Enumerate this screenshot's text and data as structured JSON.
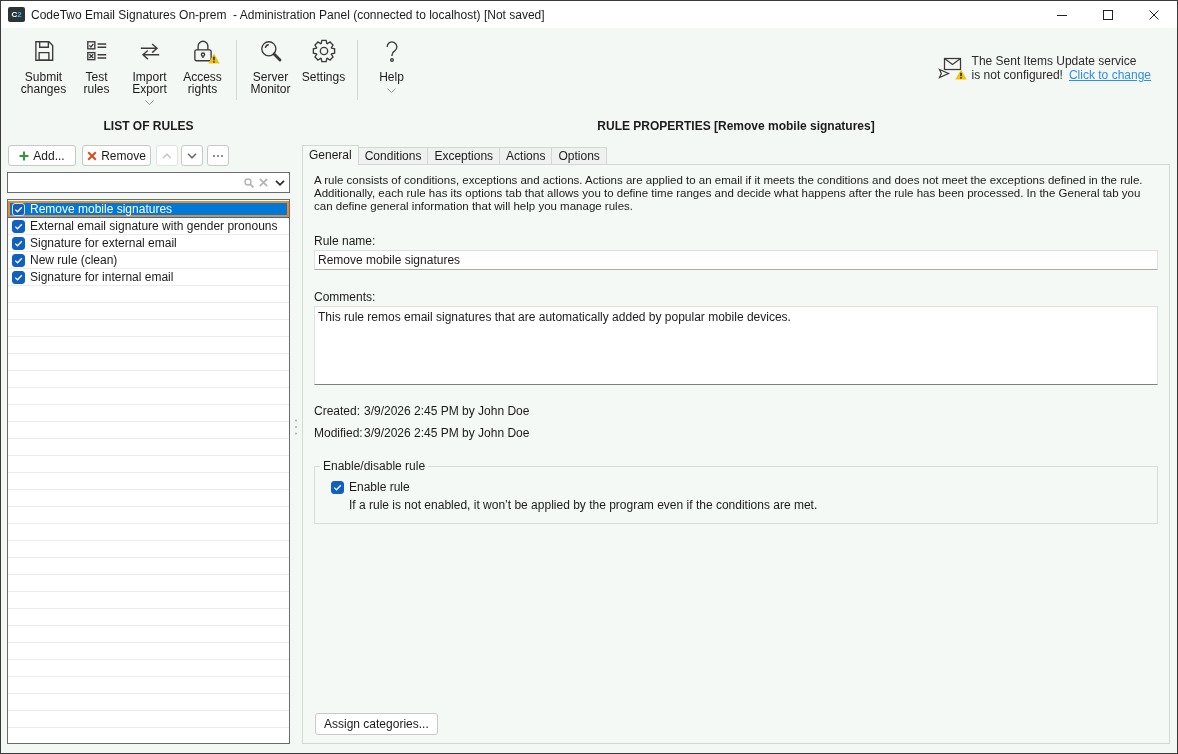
{
  "window": {
    "icon_text": "C2",
    "title": "CodeTwo Email Signatures On-prem  - Administration Panel (connected to localhost) [Not saved]"
  },
  "toolbar": {
    "groups": [
      [
        {
          "label": "Submit changes",
          "dropdown": false,
          "warning": false
        },
        {
          "label": "Test rules",
          "dropdown": false,
          "warning": false
        },
        {
          "label": "Import Export",
          "dropdown": true,
          "warning": false
        },
        {
          "label": "Access rights",
          "dropdown": false,
          "warning": true
        }
      ],
      [
        {
          "label": "Server Monitor",
          "dropdown": false,
          "warning": false
        },
        {
          "label": "Settings",
          "dropdown": false,
          "warning": false
        }
      ],
      [
        {
          "label": "Help",
          "dropdown": true,
          "warning": false
        }
      ]
    ]
  },
  "notice": {
    "text_lines": [
      "The Sent Items Update service",
      "is not configured!"
    ],
    "link": "Click to change"
  },
  "left_panel": {
    "title": "LIST OF RULES",
    "buttons": [
      {
        "kind": "add",
        "label": "Add...",
        "disabled": false
      },
      {
        "kind": "remove",
        "label": "Remove",
        "disabled": false
      },
      {
        "kind": "up",
        "disabled": true
      },
      {
        "kind": "down",
        "disabled": false
      },
      {
        "kind": "more",
        "disabled": false
      }
    ],
    "rules": [
      {
        "name": "Remove mobile signatures",
        "checked": true,
        "selected": true
      },
      {
        "name": "External email signature with gender pronouns",
        "checked": true,
        "selected": false
      },
      {
        "name": "Signature for external email",
        "checked": true,
        "selected": false
      },
      {
        "name": "New rule (clean)",
        "checked": true,
        "selected": false
      },
      {
        "name": "Signature for internal email",
        "checked": true,
        "selected": false
      }
    ]
  },
  "right_panel": {
    "title": "RULE PROPERTIES [Remove mobile signatures]",
    "tabs": [
      {
        "label": "General",
        "selected": true
      },
      {
        "label": "Conditions",
        "selected": false
      },
      {
        "label": "Exceptions",
        "selected": false
      },
      {
        "label": "Actions",
        "selected": false
      },
      {
        "label": "Options",
        "selected": false
      }
    ],
    "description": "A rule consists of conditions, exceptions and actions. Actions are applied to an email if it meets the conditions and does not meet the exceptions defined in the rule. Additionally, each rule has its options tab that allows you to define time ranges and decide what happens after the rule has been processed. In the General tab you can define general information that will help you manage rules.",
    "rule_name": {
      "label": "Rule name:",
      "value": "Remove mobile signatures"
    },
    "comments": {
      "label": "Comments:",
      "value": "This rule remos email signatures that are automatically added by popular mobile devices."
    },
    "created": {
      "label": "Created:",
      "value": "3/9/2026 2:45 PM by John Doe"
    },
    "modified": {
      "label": "Modified:",
      "value": "3/9/2026 2:45 PM by John Doe"
    },
    "enable_group": {
      "title": "Enable/disable rule",
      "checkbox": {
        "label": "Enable rule",
        "checked": true
      },
      "hint": "If a rule is not enabled, it won’t be applied by the program even if the conditions are met."
    },
    "assign_button": "Assign categories..."
  }
}
